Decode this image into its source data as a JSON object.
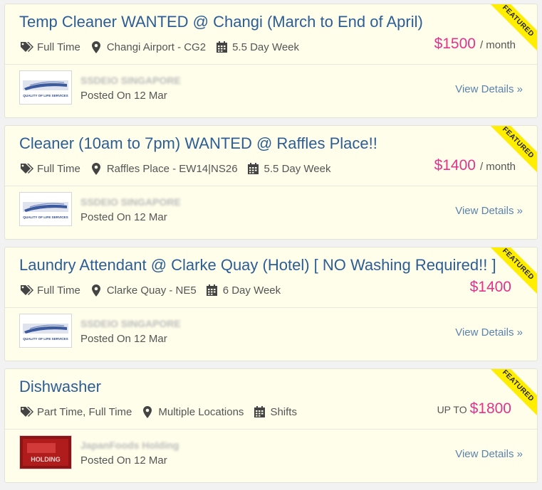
{
  "jobs": [
    {
      "title": "Temp Cleaner WANTED @ Changi (March to End of April)",
      "job_type": "Full Time",
      "location": "Changi Airport - CG2",
      "schedule": "5.5 Day Week",
      "salary_prefix": "",
      "salary": "$1500",
      "salary_period": "/ month",
      "ribbon": "FEATURED",
      "company": "SSDEIO SINGAPORE",
      "logo_text": "QUALITY OF LIFE SERVICES",
      "posted": "Posted On 12 Mar",
      "view_label": "View Details »"
    },
    {
      "title": "Cleaner (10am to 7pm) WANTED @ Raffles Place!!",
      "job_type": "Full Time",
      "location": "Raffles Place - EW14|NS26",
      "schedule": "5.5 Day Week",
      "salary_prefix": "",
      "salary": "$1400",
      "salary_period": "/ month",
      "ribbon": "FEATURED",
      "company": "SSDEIO SINGAPORE",
      "logo_text": "QUALITY OF LIFE SERVICES",
      "posted": "Posted On 12 Mar",
      "view_label": "View Details »"
    },
    {
      "title": "Laundry Attendant @ Clarke Quay (Hotel) [ NO Washing Required!! ]",
      "job_type": "Full Time",
      "location": "Clarke Quay - NE5",
      "schedule": "6 Day Week",
      "salary_prefix": "",
      "salary": "$1400",
      "salary_period": "",
      "ribbon": "FEATURED",
      "company": "SSDEIO SINGAPORE",
      "logo_text": "QUALITY OF LIFE SERVICES",
      "posted": "Posted On 12 Mar",
      "view_label": "View Details »"
    },
    {
      "title": "Dishwasher",
      "job_type": "Part Time, Full Time",
      "location": "Multiple Locations",
      "schedule": "Shifts",
      "salary_prefix": "UP TO",
      "salary": "$1800",
      "salary_period": "",
      "ribbon": "FEATURED",
      "company": "JapanFoods Holding",
      "logo_text": "HOLDING",
      "posted": "Posted On 12 Mar",
      "view_label": "View Details »"
    }
  ],
  "colors": {
    "card_bg": "#fffeeb",
    "title": "#2c5d95",
    "salary": "#e3338a",
    "ribbon": "#ffee00",
    "link": "#5b83ad"
  }
}
